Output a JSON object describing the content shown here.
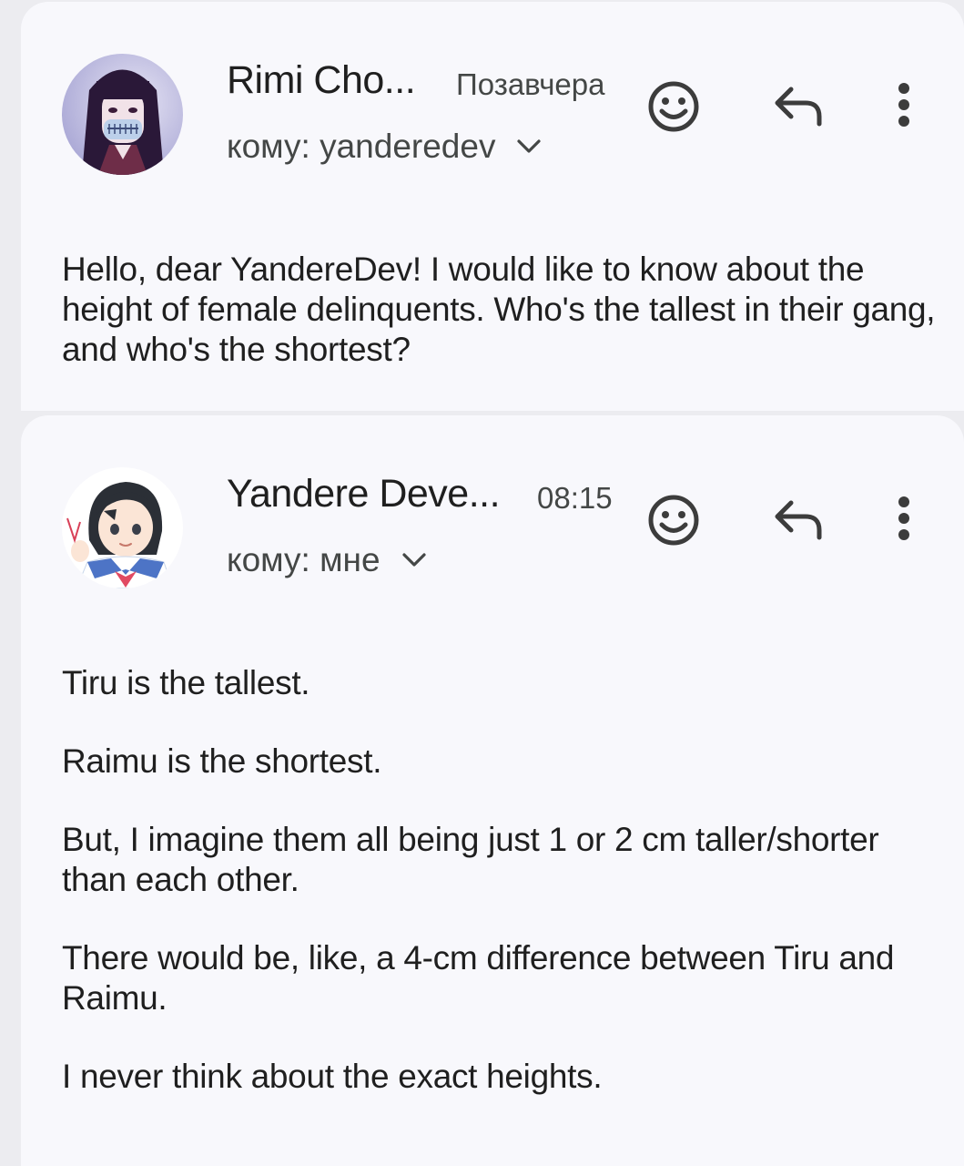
{
  "messages": [
    {
      "sender": "Rimi Cho...",
      "time": "Позавчера",
      "recipient": "кому: yanderedev",
      "avatar_icon": "avatar-dark-hair-mask",
      "body": [
        "Hello, dear YandereDev! I would like to know about the height of female delinquents. Who's the tallest in their gang, and who's the shortest?"
      ]
    },
    {
      "sender": "Yandere Deve...",
      "time": "08:15",
      "recipient": "кому: мне",
      "avatar_icon": "avatar-anime-schoolgirl",
      "body": [
        "Tiru is the tallest.",
        "Raimu is the shortest.",
        "But, I imagine them all being just 1 or 2 cm taller/shorter than each other.",
        "There would be, like, a 4-cm difference between Tiru and Raimu.",
        "I never think about the exact heights."
      ]
    }
  ],
  "icons": {
    "emoji": "smiley-icon",
    "reply": "reply-arrow-icon",
    "more": "more-vertical-icon",
    "expand": "chevron-down-icon"
  },
  "colors": {
    "background": "#ececf0",
    "card": "#f8f8fc",
    "text_primary": "#1f1f1f",
    "text_secondary": "#444746"
  }
}
